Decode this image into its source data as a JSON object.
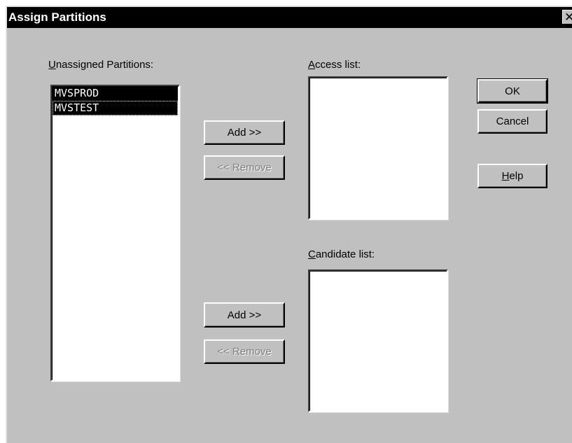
{
  "window": {
    "title": "Assign Partitions",
    "close_glyph": "✕"
  },
  "unassigned": {
    "label_mnemonic": "U",
    "label_rest": "nassigned Partitions:",
    "items": [
      "MVSPROD",
      "MVSTEST"
    ]
  },
  "access": {
    "label_mnemonic": "A",
    "label_rest": "ccess list:",
    "add_label": "Add >>",
    "remove_label": "<< Remove"
  },
  "candidate": {
    "label_mnemonic": "C",
    "label_rest": "andidate list:",
    "add_label": "Add >>",
    "remove_label": "<< Remove"
  },
  "actions": {
    "ok_label": "OK",
    "cancel_label": "Cancel",
    "help_mnemonic": "H",
    "help_rest": "elp"
  }
}
